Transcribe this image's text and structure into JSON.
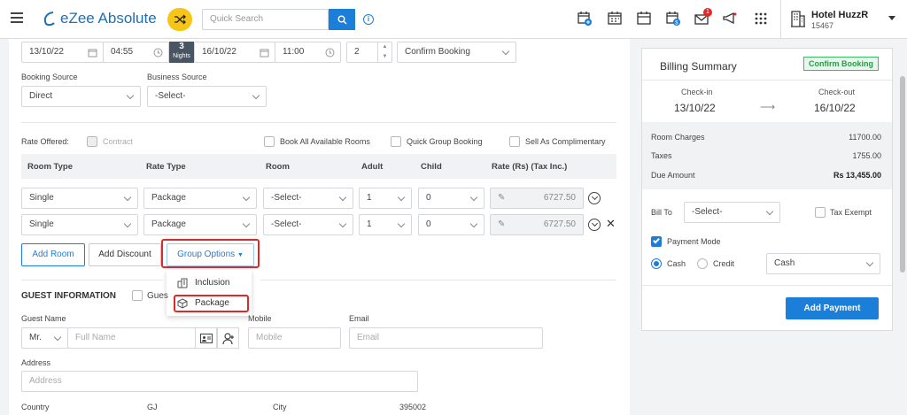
{
  "header": {
    "logo_text": "eZee Absolute",
    "search_placeholder": "Quick Search",
    "hotel_name": "Hotel HuzzR",
    "hotel_id": "15467",
    "notification_badge": "1",
    "icons": [
      "calendar-plus-icon",
      "calendar-grid-icon",
      "calendar-icon",
      "calendar-dollar-icon",
      "mail-icon",
      "megaphone-icon",
      "apps-grid-icon"
    ],
    "accent_color": "#1b7fd9"
  },
  "booking": {
    "checkin_date": "13/10/22",
    "checkin_time": "04:55",
    "nights_count": "3",
    "nights_label": "Nights",
    "checkout_date": "16/10/22",
    "checkout_time": "11:00",
    "room_count": "2",
    "status": "Confirm Booking",
    "booking_source_label": "Booking Source",
    "booking_source_value": "Direct",
    "business_source_label": "Business Source",
    "business_source_value": "-Select-"
  },
  "rate_options": {
    "rate_offered_label": "Rate Offered:",
    "contract_label": "Contract",
    "book_all_label": "Book All Available Rooms",
    "quick_group_label": "Quick Group Booking",
    "complimentary_label": "Sell As Complimentary"
  },
  "rooms_table": {
    "headers": [
      "Room Type",
      "Rate Type",
      "Room",
      "Adult",
      "Child",
      "Rate (Rs)  (Tax Inc.)"
    ],
    "rows": [
      {
        "room_type": "Single",
        "rate_type": "Package",
        "room": "-Select-",
        "adult": "1",
        "child": "0",
        "rate": "6727.50"
      },
      {
        "room_type": "Single",
        "rate_type": "Package",
        "room": "-Select-",
        "adult": "1",
        "child": "0",
        "rate": "6727.50"
      }
    ]
  },
  "actions": {
    "add_room": "Add Room",
    "add_discount": "Add Discount",
    "group_options": "Group Options",
    "menu": [
      "Inclusion",
      "Package"
    ]
  },
  "guest": {
    "section_title": "GUEST INFORMATION",
    "guest_checkbox_label": "Gues",
    "guest_name_label": "Guest Name",
    "salutation": "Mr.",
    "full_name_placeholder": "Full Name",
    "mobile_label": "Mobile",
    "mobile_placeholder": "Mobile",
    "email_label": "Email",
    "email_placeholder": "Email",
    "address_label": "Address",
    "address_placeholder": "Address",
    "country_label": "Country",
    "state_value": "GJ",
    "city_label": "City",
    "zip_value": "395002"
  },
  "billing": {
    "title": "Billing Summary",
    "status_badge": "Confirm Booking",
    "checkin_label": "Check-in",
    "checkin_date": "13/10/22",
    "checkout_label": "Check-out",
    "checkout_date": "16/10/22",
    "room_charges_label": "Room Charges",
    "room_charges_value": "11700.00",
    "taxes_label": "Taxes",
    "taxes_value": "1755.00",
    "due_label": "Due Amount",
    "due_value": "Rs 13,455.00",
    "bill_to_label": "Bill To",
    "bill_to_value": "-Select-",
    "tax_exempt_label": "Tax Exempt",
    "payment_mode_label": "Payment Mode",
    "cash_label": "Cash",
    "credit_label": "Credit",
    "payment_type_value": "Cash",
    "add_payment": "Add Payment"
  }
}
